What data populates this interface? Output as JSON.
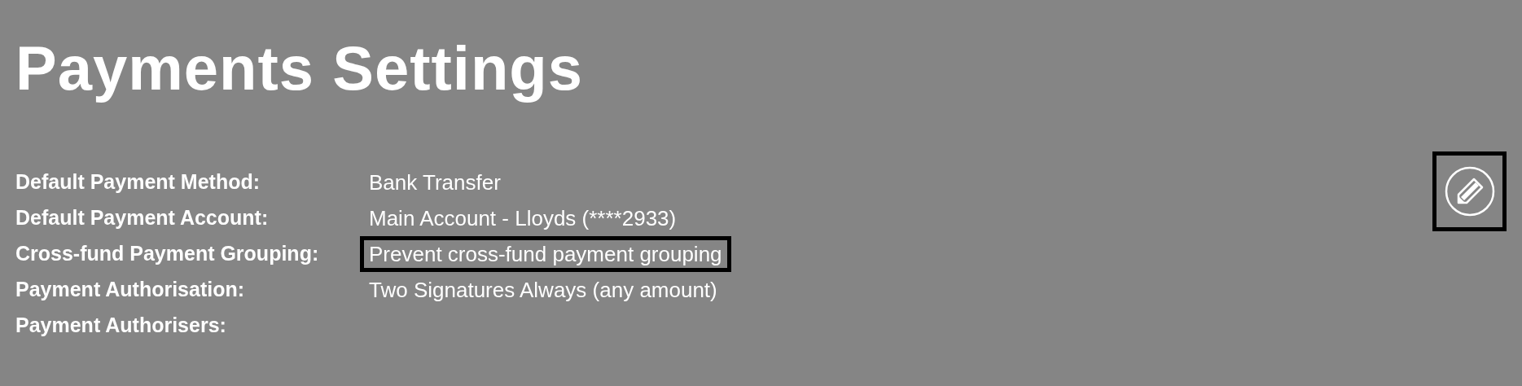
{
  "title": "Payments Settings",
  "fields": [
    {
      "label": "Default Payment Method:",
      "value": "Bank Transfer",
      "highlighted": false
    },
    {
      "label": "Default Payment Account:",
      "value": "Main Account - Lloyds (****2933)",
      "highlighted": false
    },
    {
      "label": "Cross-fund Payment Grouping:",
      "value": "Prevent cross-fund payment grouping",
      "highlighted": true
    },
    {
      "label": "Payment Authorisation:",
      "value": "Two Signatures Always (any amount)",
      "highlighted": false
    },
    {
      "label": "Payment Authorisers:",
      "highlighted": false
    }
  ],
  "edit_button": {
    "highlighted": true
  }
}
